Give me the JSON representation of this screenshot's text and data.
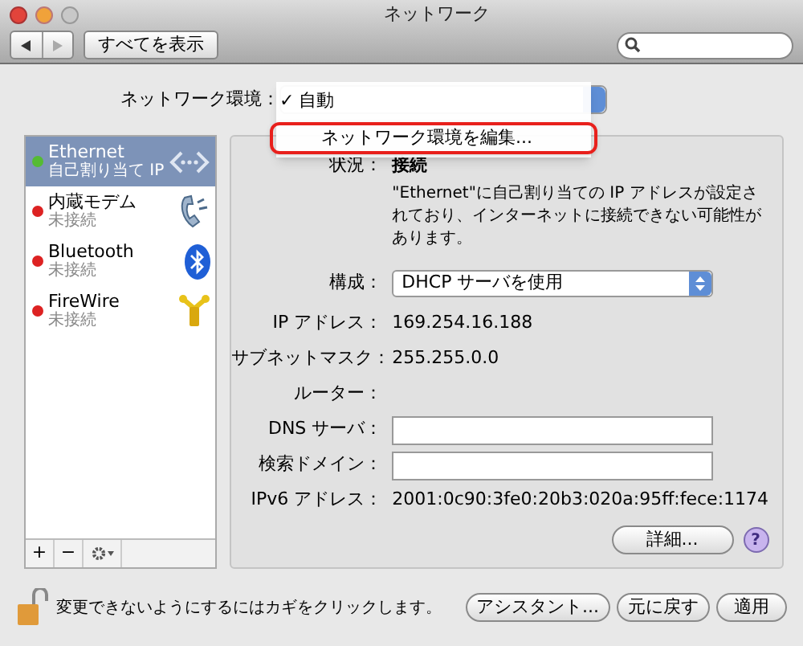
{
  "window": {
    "title": "ネットワーク"
  },
  "toolbar": {
    "show_all": "すべてを表示"
  },
  "location": {
    "label": "ネットワーク環境：",
    "check_mark": "✓",
    "menu": [
      {
        "label": "自動",
        "checked": true,
        "annotated": false
      },
      {
        "label": "ネットワーク環境を編集...",
        "checked": false,
        "annotated": true
      }
    ]
  },
  "services": [
    {
      "name": "Ethernet",
      "status": "自己割り当て IP",
      "color": "#55bb33",
      "selected": true,
      "kind": "ethernet"
    },
    {
      "name": "内蔵モデム",
      "status": "未接続",
      "color": "#dd2222",
      "selected": false,
      "kind": "modem"
    },
    {
      "name": "Bluetooth",
      "status": "未接続",
      "color": "#dd2222",
      "selected": false,
      "kind": "bluetooth"
    },
    {
      "name": "FireWire",
      "status": "未接続",
      "color": "#dd2222",
      "selected": false,
      "kind": "firewire"
    }
  ],
  "service_buttons": [
    "+",
    "−"
  ],
  "detail": {
    "status_label": "状況：",
    "status": "接続",
    "description": "\"Ethernet\"に自己割り当ての IP アドレスが設定されており、インターネットに接続できない可能性があります。",
    "config_label": "構成：",
    "config": "DHCP サーバを使用",
    "rows": [
      {
        "kind": "text",
        "label": "IP アドレス：",
        "value": "169.254.16.188"
      },
      {
        "kind": "text",
        "label": "サブネットマスク：",
        "value": "255.255.0.0"
      },
      {
        "kind": "text",
        "label": "ルーター："
      },
      {
        "kind": "field",
        "label": "DNS サーバ："
      },
      {
        "kind": "field",
        "label": "検索ドメイン："
      },
      {
        "kind": "text",
        "label": "IPv6 アドレス：",
        "value": "2001:0c90:3fe0:20b3:020a:95ff:fece:1174"
      }
    ],
    "advanced": "詳細...",
    "help": "?"
  },
  "footer": {
    "lock_text": "変更できないようにするにはカギをクリックします。",
    "buttons": [
      "アシスタント...",
      "元に戻す",
      "適用"
    ]
  }
}
